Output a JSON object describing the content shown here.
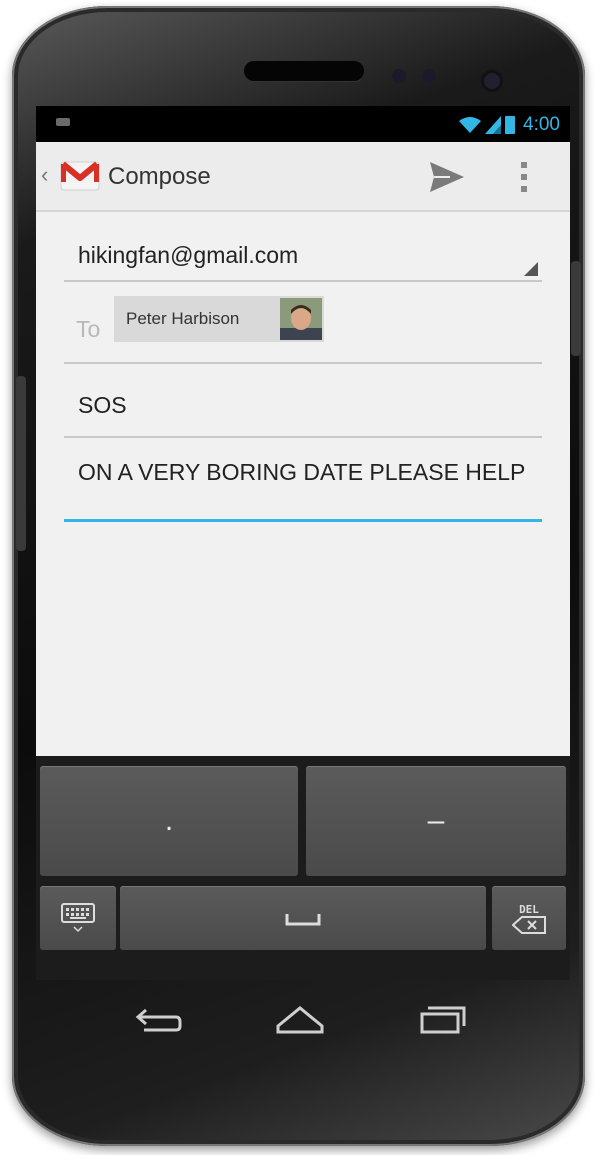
{
  "status_bar": {
    "time": "4:00"
  },
  "action_bar": {
    "title": "Compose"
  },
  "compose": {
    "from": "hikingfan@gmail.com",
    "to_label": "To",
    "recipient_name": "Peter Harbison",
    "subject": "SOS",
    "body": "ON A VERY BORING DATE PLEASE HELP"
  },
  "keyboard": {
    "key_dot": ".",
    "key_dash": "–",
    "key_del": "DEL"
  },
  "colors": {
    "accent": "#33b5e5",
    "gmail_red": "#d93025"
  }
}
